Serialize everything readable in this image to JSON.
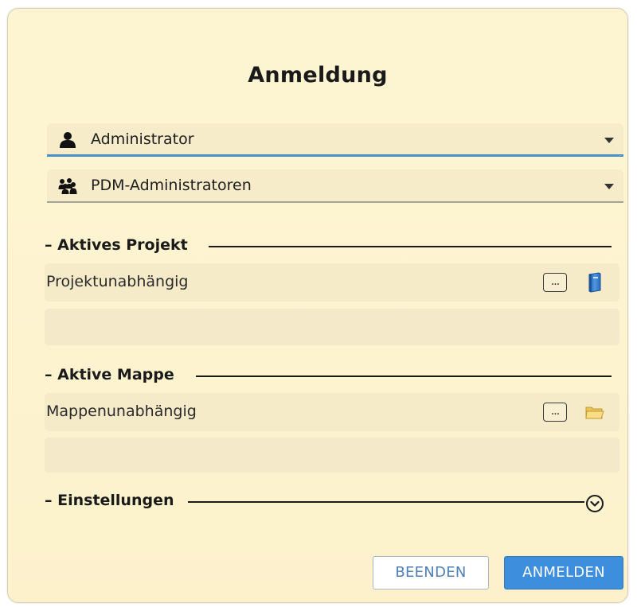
{
  "dialog": {
    "title": "Anmeldung"
  },
  "user": {
    "value": "Administrator",
    "icon": "user-icon"
  },
  "group": {
    "value": "PDM-Administratoren",
    "icon": "user-group-icon"
  },
  "project_section": {
    "label": "– Aktives Projekt",
    "value": "Projektunabhängig",
    "browse_label": "...",
    "icon": "project-book-icon"
  },
  "folder_section": {
    "label": "– Aktive Mappe",
    "value": "Mappenunabhängig",
    "browse_label": "...",
    "icon": "folder-icon"
  },
  "settings_section": {
    "label": "– Einstellungen",
    "expand_icon": "chevron-down-circle-icon"
  },
  "buttons": {
    "cancel": "BEENDEN",
    "login": "ANMELDEN"
  },
  "colors": {
    "dialog_background": "#fdf4d2",
    "field_background": "#f6ebc9",
    "primary_button": "#3d8fdd",
    "active_underline": "#4a90c8"
  }
}
